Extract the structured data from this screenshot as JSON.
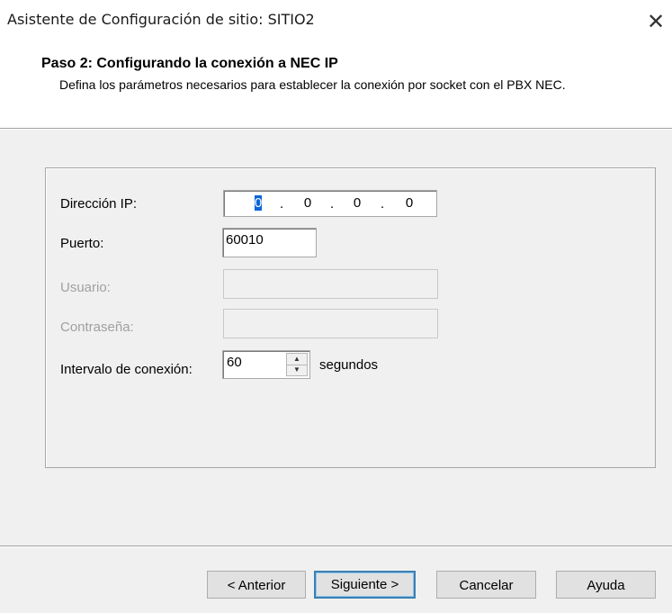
{
  "window": {
    "title": "Asistente de Configuración de sitio: SITIO2",
    "close_glyph": "✕"
  },
  "header": {
    "step_title": "Paso 2: Configurando la conexión a NEC IP",
    "description": "Defina los parámetros necesarios para establecer la conexión por socket con el PBX NEC."
  },
  "form": {
    "ip_label": "Dirección IP:",
    "ip_octets": [
      "0",
      "0",
      "0",
      "0"
    ],
    "ip_separator": ".",
    "port_label": "Puerto:",
    "port_value": "60010",
    "user_label": "Usuario:",
    "user_value": "",
    "password_label": "Contraseña:",
    "password_value": "",
    "interval_label": "Intervalo de conexión:",
    "interval_value": "60",
    "interval_unit": "segundos",
    "spin_up_glyph": "▲",
    "spin_down_glyph": "▼"
  },
  "buttons": {
    "prev": "< Anterior",
    "next": "Siguiente >",
    "cancel": "Cancelar",
    "help": "Ayuda"
  },
  "colors": {
    "selection": "#0a64d8",
    "default_button_border": "#3c7fb1",
    "panel_background": "#f0f0f0"
  }
}
